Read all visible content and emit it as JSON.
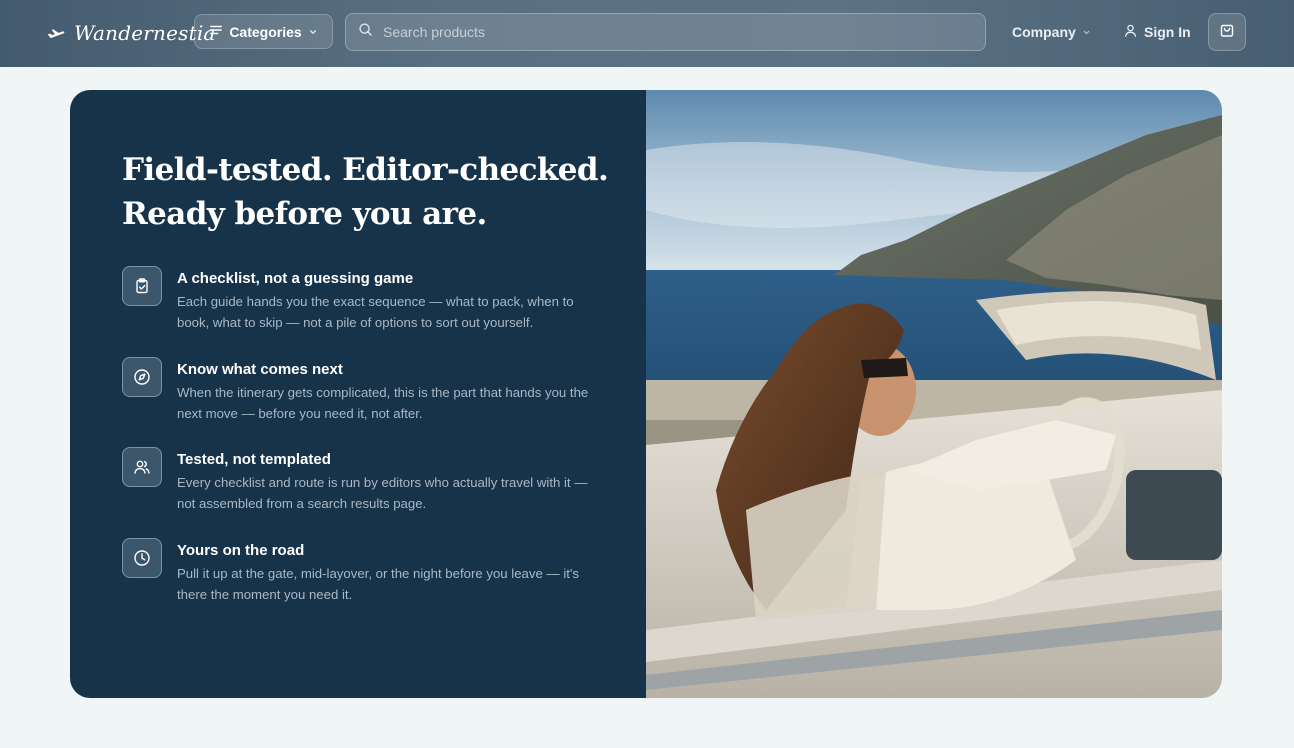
{
  "header": {
    "brand": "Wandernestia",
    "categories_label": "Categories",
    "search_placeholder": "Search products",
    "company_label": "Company",
    "signin_label": "Sign In"
  },
  "hero": {
    "headline": "Field-tested. Editor-checked. Ready before you are.",
    "features": [
      {
        "icon": "clipboard-check-icon",
        "title": "A checklist, not a guessing game",
        "desc": "Each guide hands you the exact sequence — what to pack, when to book, what to skip — not a pile of options to sort out yourself."
      },
      {
        "icon": "compass-icon",
        "title": "Know what comes next",
        "desc": "When the itinerary gets complicated, this is the part that hands you the next move — before you need it, not after."
      },
      {
        "icon": "users-icon",
        "title": "Tested, not templated",
        "desc": "Every checklist and route is run by editors who actually travel with it — not assembled from a search results page."
      },
      {
        "icon": "clock-icon",
        "title": "Yours on the road",
        "desc": "Pull it up at the gate, mid-layover, or the night before you leave — it's there the moment you need it."
      }
    ]
  },
  "colors": {
    "panel": "#17334a",
    "page_bg": "#f0f5f5",
    "header": "#536a7d"
  }
}
